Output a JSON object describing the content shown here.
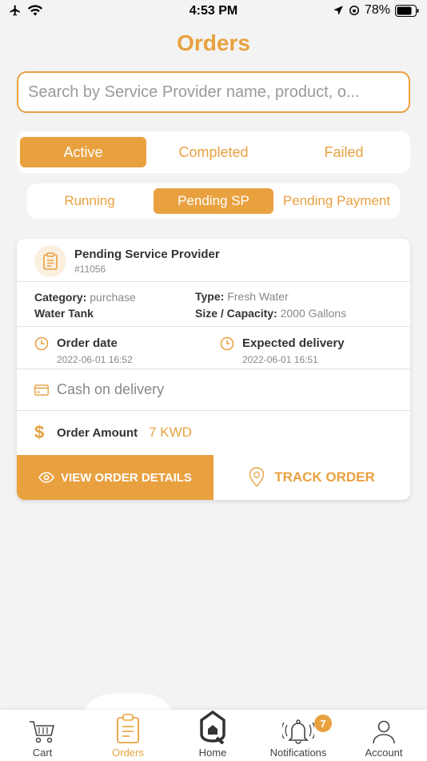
{
  "status_bar": {
    "time": "4:53 PM",
    "battery": "78%"
  },
  "page_title": "Orders",
  "search": {
    "placeholder": "Search by Service Provider name, product, o..."
  },
  "main_tabs": [
    {
      "label": "Active",
      "active": true
    },
    {
      "label": "Completed",
      "active": false
    },
    {
      "label": "Failed",
      "active": false
    }
  ],
  "sub_tabs": [
    {
      "label": "Running",
      "active": false
    },
    {
      "label": "Pending SP",
      "active": true
    },
    {
      "label": "Pending Payment",
      "active": false
    }
  ],
  "order": {
    "status": "Pending Service Provider",
    "id": "#11056",
    "category_label": "Category:",
    "category": "purchase",
    "product": "Water Tank",
    "type_label": "Type:",
    "type": "Fresh Water",
    "size_label": "Size / Capacity:",
    "size": "2000 Gallons",
    "order_date_label": "Order date",
    "order_date": "2022-06-01 16:52",
    "expected_label": "Expected delivery",
    "expected_date": "2022-06-01 16:51",
    "payment_method": "Cash on delivery",
    "amount_label": "Order Amount",
    "amount": "7 KWD",
    "view_button": "VIEW ORDER DETAILS",
    "track_button": "TRACK ORDER"
  },
  "bottom_nav": {
    "items": [
      {
        "label": "Cart",
        "icon": "cart-icon",
        "active": false
      },
      {
        "label": "Orders",
        "icon": "clipboard-icon",
        "active": true
      },
      {
        "label": "Home",
        "icon": "home-logo-icon",
        "active": false
      },
      {
        "label": "Notifications",
        "icon": "bell-icon",
        "active": false
      },
      {
        "label": "Account",
        "icon": "user-icon",
        "active": false
      }
    ],
    "notification_count": "7"
  },
  "colors": {
    "accent": "#e9a140",
    "background": "#f3f3f3"
  }
}
